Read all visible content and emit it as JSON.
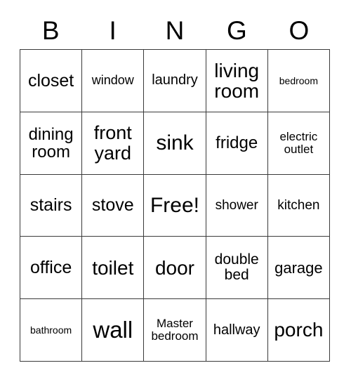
{
  "card": {
    "header_letters": [
      "B",
      "I",
      "N",
      "G",
      "O"
    ],
    "rows": [
      [
        {
          "text": "closet",
          "size": "fs-lg2"
        },
        {
          "text": "window",
          "size": "fs-sm2"
        },
        {
          "text": "laundry",
          "size": "fs-md2"
        },
        {
          "text": "living room",
          "size": "fs-xl2"
        },
        {
          "text": "bedroom",
          "size": "fs-xs"
        }
      ],
      [
        {
          "text": "dining room",
          "size": "fs-lg"
        },
        {
          "text": "front yard",
          "size": "fs-xl"
        },
        {
          "text": "sink",
          "size": "fs-xxl"
        },
        {
          "text": "fridge",
          "size": "fs-lg"
        },
        {
          "text": "electric outlet",
          "size": "fs-sm"
        }
      ],
      [
        {
          "text": "stairs",
          "size": "fs-lg2"
        },
        {
          "text": "stove",
          "size": "fs-lg2"
        },
        {
          "text": "Free!",
          "size": "fs-xxl"
        },
        {
          "text": "shower",
          "size": "fs-md"
        },
        {
          "text": "kitchen",
          "size": "fs-md"
        }
      ],
      [
        {
          "text": "office",
          "size": "fs-lg2"
        },
        {
          "text": "toilet",
          "size": "fs-xl2"
        },
        {
          "text": "door",
          "size": "fs-xl2"
        },
        {
          "text": "double bed",
          "size": "fs-md3"
        },
        {
          "text": "garage",
          "size": "fs-md4"
        }
      ],
      [
        {
          "text": "bathroom",
          "size": "fs-xs"
        },
        {
          "text": "wall",
          "size": "fs-huge"
        },
        {
          "text": "Master bedroom",
          "size": "fs-sm"
        },
        {
          "text": "hallway",
          "size": "fs-md2"
        },
        {
          "text": "porch",
          "size": "fs-xl2"
        }
      ]
    ]
  }
}
